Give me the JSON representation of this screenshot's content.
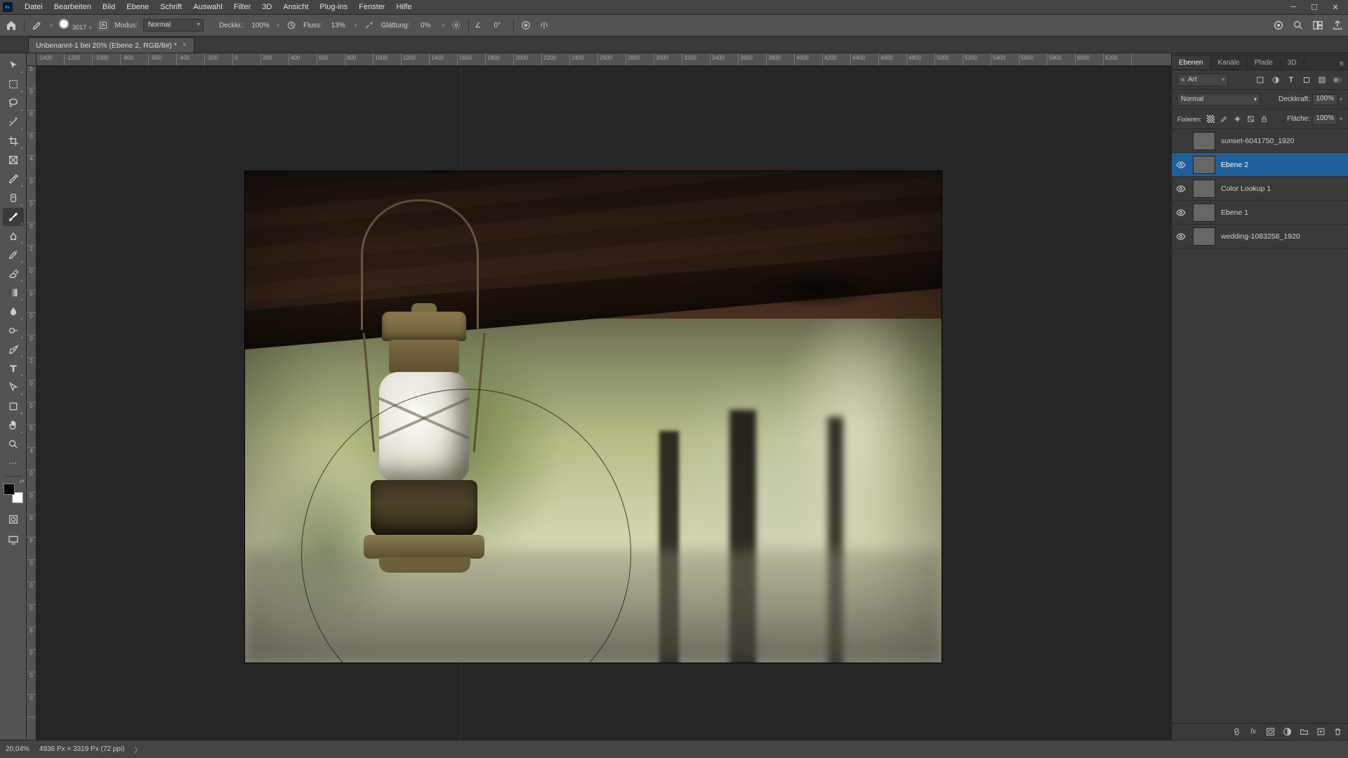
{
  "menu": {
    "items": [
      "Datei",
      "Bearbeiten",
      "Bild",
      "Ebene",
      "Schrift",
      "Auswahl",
      "Filter",
      "3D",
      "Ansicht",
      "Plug-ins",
      "Fenster",
      "Hilfe"
    ]
  },
  "options": {
    "brush_size": "3017",
    "mode_label": "Modus:",
    "mode_value": "Normal",
    "opacity_label": "Deckkr.:",
    "opacity_value": "100%",
    "flow_label": "Fluss:",
    "flow_value": "13%",
    "smoothing_label": "Glättung:",
    "smoothing_value": "0%",
    "angle_icon": "∠",
    "angle_value": "0°"
  },
  "doc": {
    "tab_title": "Unbenannt-1 bei 20% (Ebene 2, RGB/8#) *"
  },
  "ruler_h": [
    "-1400",
    "-1200",
    "-1000",
    "-800",
    "-600",
    "-400",
    "-200",
    "0",
    "200",
    "400",
    "600",
    "800",
    "1000",
    "1200",
    "1400",
    "1600",
    "1800",
    "2000",
    "2200",
    "2400",
    "2600",
    "2800",
    "3000",
    "3200",
    "3400",
    "3600",
    "3800",
    "4000",
    "4200",
    "4400",
    "4600",
    "4800",
    "5000",
    "5200",
    "5400",
    "5600",
    "5800",
    "6000",
    "6200"
  ],
  "ruler_v": [
    "6",
    "0",
    "0",
    "0",
    "4",
    "0",
    "0",
    "0",
    "2",
    "0",
    "0",
    "0",
    "0",
    "2",
    "0",
    "0",
    "0",
    "4",
    "0",
    "0",
    "0",
    "6",
    "0",
    "0",
    "0",
    "8",
    "0",
    "0",
    "0"
  ],
  "panel": {
    "tabs": {
      "layers": "Ebenen",
      "channels": "Kanäle",
      "paths": "Pfade",
      "three_d": "3D"
    },
    "search_placeholder": "Art",
    "blend_mode": "Normal",
    "opacity_label": "Deckkraft:",
    "opacity_value": "100%",
    "lock_label": "Fixieren:",
    "fill_label": "Fläche:",
    "fill_value": "100%",
    "layers": [
      {
        "name": "sunset-6041750_1920",
        "visible": false,
        "thumb": "img1"
      },
      {
        "name": "Ebene 2",
        "visible": true,
        "thumb": "transp",
        "selected": true
      },
      {
        "name": "Color Lookup 1",
        "visible": true,
        "thumb": "lut"
      },
      {
        "name": "Ebene 1",
        "visible": true,
        "thumb": "transp"
      },
      {
        "name": "wedding-1083258_1920",
        "visible": true,
        "thumb": "photo"
      }
    ]
  },
  "status": {
    "zoom": "20,04%",
    "doc_info": "4936 Px × 3319 Px (72 ppi)"
  }
}
